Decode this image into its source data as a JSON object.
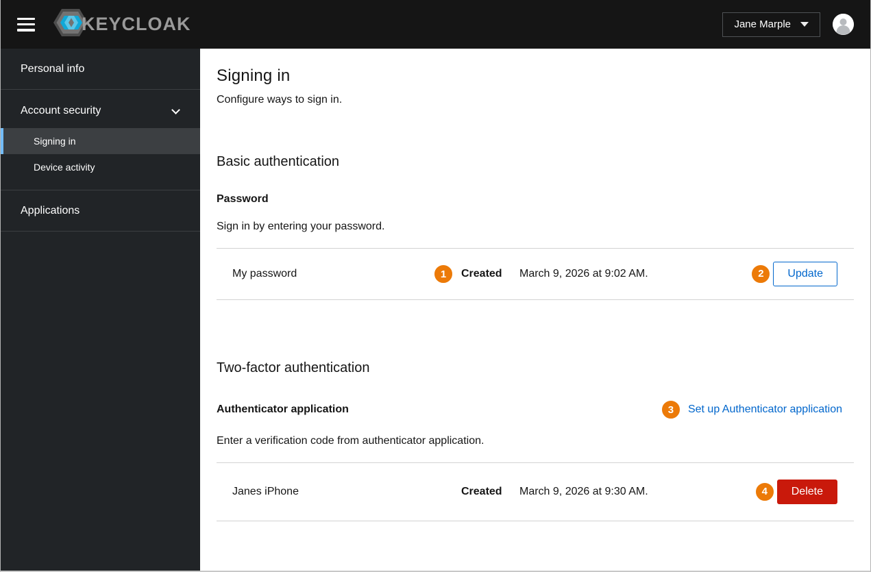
{
  "colors": {
    "masthead_bg": "#151515",
    "sidebar_bg": "#212427",
    "sidebar_active_bg": "#3c3f42",
    "sidebar_active_accent": "#73bcf7",
    "badge_orange": "#ec7a08",
    "link_blue": "#0066cc",
    "danger_red": "#c9190b",
    "row_border": "#d2d2d2"
  },
  "header": {
    "brand": "KEYCLOAK",
    "hamburger_icon": "menu-icon",
    "user_name": "Jane Marple",
    "avatar_icon": "user-avatar-icon"
  },
  "sidebar": {
    "personal_info": "Personal info",
    "account_security": "Account security",
    "signing_in": "Signing in",
    "device_activity": "Device activity",
    "applications": "Applications"
  },
  "main": {
    "title": "Signing in",
    "subtitle": "Configure ways to sign in.",
    "basic": {
      "heading": "Basic authentication",
      "item_title": "Password",
      "item_desc": "Sign in by entering your password.",
      "row": {
        "name": "My password",
        "badge": "1",
        "created_label": "Created",
        "created_value": "March 9, 2026 at 9:02 AM.",
        "action_badge": "2",
        "action_label": "Update"
      }
    },
    "twofactor": {
      "heading": "Two-factor authentication",
      "item_title": "Authenticator application",
      "setup_badge": "3",
      "setup_link": "Set up Authenticator application",
      "item_desc": "Enter a verification code from authenticator application.",
      "row": {
        "name": "Janes iPhone",
        "created_label": "Created",
        "created_value": "March 9, 2026 at 9:30 AM.",
        "action_badge": "4",
        "action_label": "Delete"
      }
    }
  }
}
